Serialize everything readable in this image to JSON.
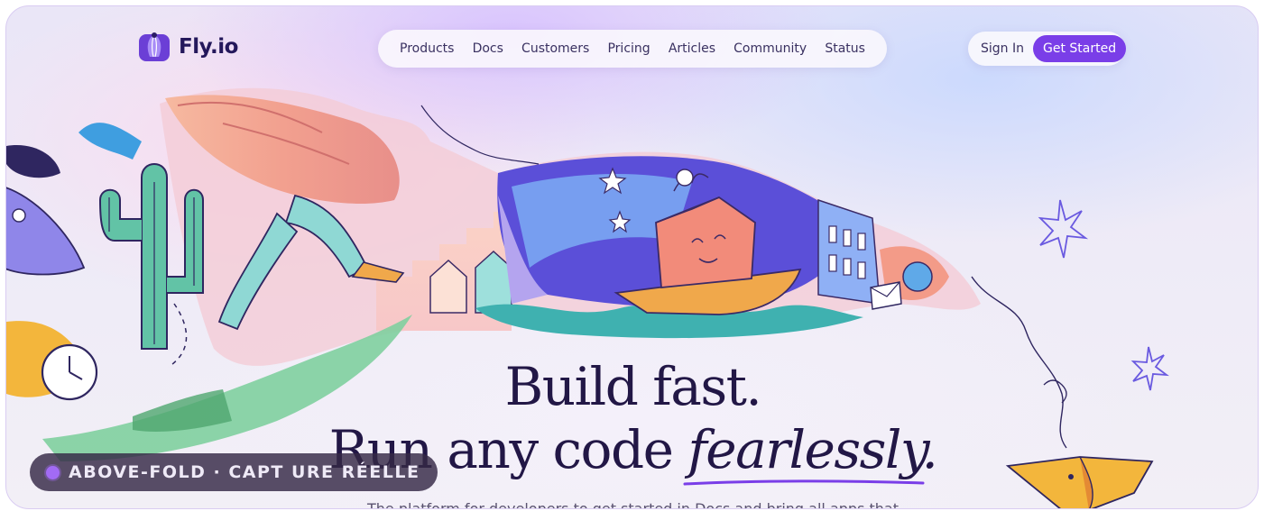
{
  "brand": {
    "name": "Fly.io",
    "accent": "#7a3ee8",
    "ink": "#221746"
  },
  "nav": {
    "items": [
      {
        "label": "Products"
      },
      {
        "label": "Docs"
      },
      {
        "label": "Customers"
      },
      {
        "label": "Pricing"
      },
      {
        "label": "Articles"
      },
      {
        "label": "Community"
      },
      {
        "label": "Status"
      }
    ]
  },
  "auth": {
    "sign_in": "Sign In",
    "get_started": "Get Started"
  },
  "hero": {
    "line1": "Build fast.",
    "line2_prefix": "Run any code ",
    "line2_emphasis": "fearlessly.",
    "subtext": "The platform for developers to get started in Docs and bring all apps that"
  },
  "badge": {
    "label": "ABOVE-FOLD · CAPT URE RÉELLE"
  },
  "illustration": {
    "icons": [
      "balloon-logo-icon",
      "ship-icon",
      "cactus-icon",
      "clock-icon",
      "rocket-icon",
      "sparkle-icon",
      "bird-icon",
      "envelope-icon"
    ]
  }
}
